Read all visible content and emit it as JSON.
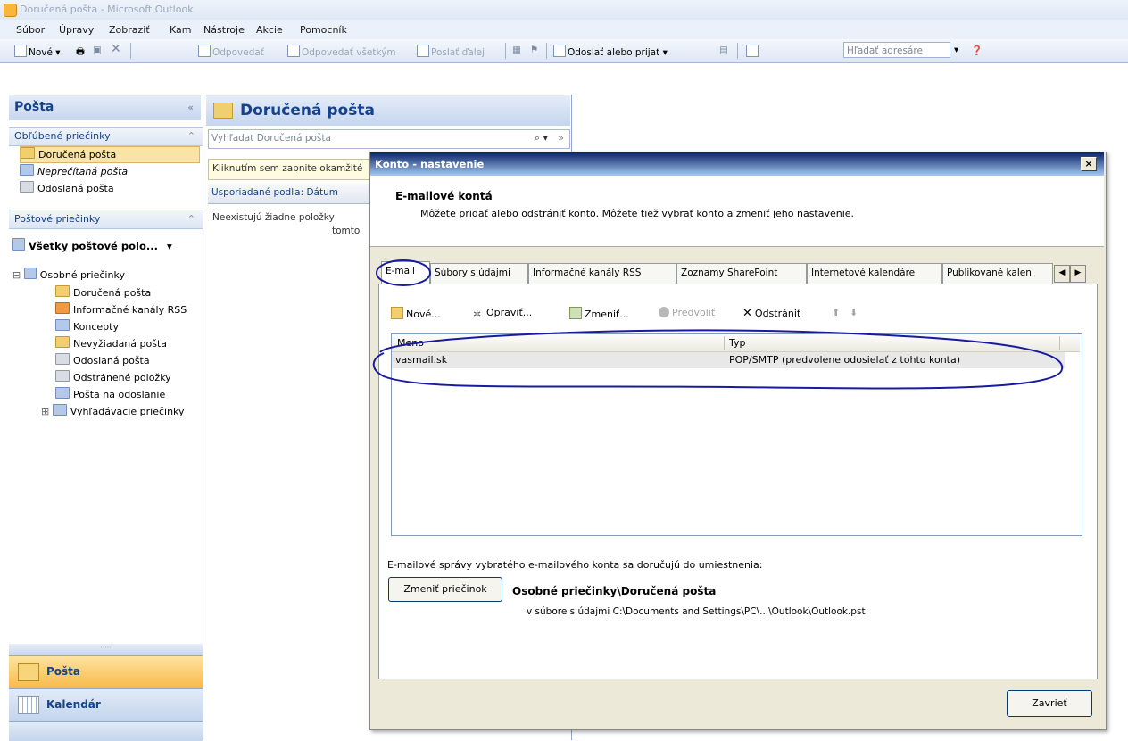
{
  "window": {
    "title": "Doručená pošta - Microsoft Outlook"
  },
  "menu": [
    "Súbor",
    "Úpravy",
    "Zobraziť",
    "Kam",
    "Nástroje",
    "Akcie",
    "Pomocník"
  ],
  "toolbar": {
    "new": "Nové",
    "reply": "Odpovedať",
    "reply_all": "Odpovedať všetkým",
    "forward": "Poslať ďalej",
    "send_receive": "Odoslať alebo prijať",
    "address_search_placeholder": "Hľadať adresáre"
  },
  "nav": {
    "title": "Pošta",
    "collapse": "«",
    "favorites_header": "Obľúbené priečinky",
    "favorites": [
      "Doručená pošta",
      "Neprečítaná pošta",
      "Odoslaná pošta"
    ],
    "mailboxes_header": "Poštové priečinky",
    "all_folders": "Všetky poštové polo...",
    "root": "Osobné priečinky",
    "folders": [
      "Doručená pošta",
      "Informačné kanály RSS",
      "Koncepty",
      "Nevyžiadaná pošta",
      "Odoslaná pošta",
      "Odstránené položky",
      "Pošta na odoslanie",
      "Vyhľadávacie priečinky"
    ],
    "buttons": [
      "Pošta",
      "Kalendár"
    ]
  },
  "middle": {
    "title": "Doručená pošta",
    "search_placeholder": "Vyhľadať Doručená pošta",
    "infobar": "Kliknutím sem zapnite okamžité",
    "arranged_by": "Usporiadané podľa: Dátum",
    "empty_line1": "Neexistujú žiadne položky",
    "empty_line2": "tomto"
  },
  "dialog": {
    "title": "Konto - nastavenie",
    "close": "×",
    "heading": "E-mailové kontá",
    "description": "Môžete pridať alebo odstrániť konto. Môžete tiež vybrať konto a zmeniť jeho nastavenie.",
    "tabs": [
      "E-mail",
      "Súbory s údajmi",
      "Informačné kanály RSS",
      "Zoznamy SharePoint",
      "Internetové kalendáre",
      "Publikované kalen"
    ],
    "actions": {
      "new": "Nové...",
      "repair": "Opraviť...",
      "change": "Zmeniť...",
      "default": "Predvoliť",
      "remove": "Odstrániť"
    },
    "columns": [
      "Meno",
      "Typ"
    ],
    "accounts": [
      {
        "name": "vasmail.sk",
        "type": "POP/SMTP (predvolene odosielať z tohto konta)"
      }
    ],
    "deliver_label": "E-mailové správy vybratého e-mailového konta sa doručujú do umiestnenia:",
    "change_folder": "Zmeniť priečinok",
    "deliver_path": "Osobné priečinky\\Doručená pošta",
    "deliver_file": "v súbore s údajmi C:\\Documents and Settings\\PC\\...\\Outlook\\Outlook.pst",
    "close_button": "Zavrieť"
  },
  "colors": {
    "accent": "#15428b",
    "nav_active": "#f9c15a",
    "annotation": "#1a1a9e"
  }
}
